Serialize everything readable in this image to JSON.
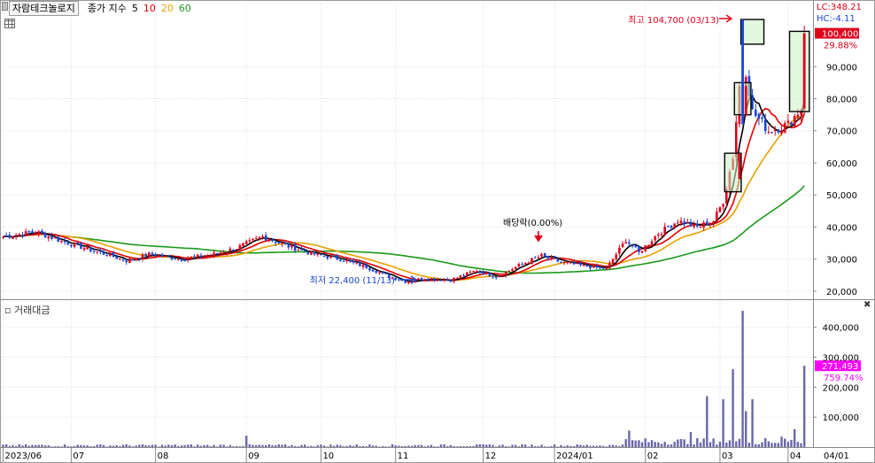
{
  "header": {
    "stock_name": "자람테크놀로지",
    "ma_label": "종가 지수",
    "ma_periods": [
      {
        "label": "5",
        "color": "#000000"
      },
      {
        "label": "10",
        "color": "#e00000"
      },
      {
        "label": "20",
        "color": "#e8a000"
      },
      {
        "label": "60",
        "color": "#1a9a1a"
      }
    ]
  },
  "price_panel": {
    "lc_label": "LC:348.21",
    "hc_label": "HC:-4.11",
    "current_price": "100,400",
    "current_change": "29.88%",
    "high_annotation": "최고 104,700 (03/13)",
    "low_annotation": "최저 22,400 (11/13)",
    "dividend_annotation": "배당락(0.00%)",
    "y_ticks": [
      {
        "v": 90000,
        "label": "90,000"
      },
      {
        "v": 80000,
        "label": "80,000"
      },
      {
        "v": 70000,
        "label": "70,000"
      },
      {
        "v": 60000,
        "label": "60,000"
      },
      {
        "v": 50000,
        "label": "50,000"
      },
      {
        "v": 40000,
        "label": "40,000"
      },
      {
        "v": 30000,
        "label": "30,000"
      },
      {
        "v": 20000,
        "label": "20,000"
      }
    ]
  },
  "volume_panel": {
    "title": "거래대금",
    "current_value": "271,493",
    "current_change": "759.74%",
    "y_ticks": [
      {
        "v": 400000,
        "label": "400,000"
      },
      {
        "v": 300000,
        "label": "300,000"
      },
      {
        "v": 200000,
        "label": "200,000"
      },
      {
        "v": 100000,
        "label": "100,000"
      }
    ]
  },
  "x_axis": {
    "ticks": [
      {
        "i": 0,
        "label": "2023/06"
      },
      {
        "i": 21,
        "label": "07"
      },
      {
        "i": 47,
        "label": "08"
      },
      {
        "i": 75,
        "label": "09"
      },
      {
        "i": 98,
        "label": "10"
      },
      {
        "i": 121,
        "label": "11"
      },
      {
        "i": 148,
        "label": "12"
      },
      {
        "i": 170,
        "label": "2024/01"
      },
      {
        "i": 198,
        "label": "02"
      },
      {
        "i": 221,
        "label": "03"
      },
      {
        "i": 242,
        "label": "04"
      }
    ],
    "last_label": "04/01"
  },
  "colors": {
    "up": "#e0001b",
    "down": "#1846d8",
    "ma5": "#000000",
    "ma10": "#e00000",
    "ma20": "#e8a000",
    "ma60": "#1a9a1a",
    "volume": "#6a67a8",
    "highlight_fill": "#c9f0c2",
    "tag_price": "#e0001b",
    "tag_volume": "#ff00ff"
  },
  "chart_data": {
    "type": "candlestick",
    "price_range": [
      17500,
      104700
    ],
    "volume_range": [
      0,
      470000
    ],
    "closing_path": [
      [
        0,
        37000
      ],
      [
        10,
        38500
      ],
      [
        20,
        35000
      ],
      [
        30,
        32000
      ],
      [
        38,
        29500
      ],
      [
        45,
        31500
      ],
      [
        55,
        30000
      ],
      [
        65,
        31500
      ],
      [
        72,
        33500
      ],
      [
        80,
        37000
      ],
      [
        88,
        34000
      ],
      [
        96,
        31500
      ],
      [
        104,
        30000
      ],
      [
        112,
        27500
      ],
      [
        118,
        25000
      ],
      [
        124,
        23000
      ],
      [
        130,
        24000
      ],
      [
        138,
        23500
      ],
      [
        146,
        26500
      ],
      [
        152,
        24500
      ],
      [
        160,
        28500
      ],
      [
        166,
        31000
      ],
      [
        172,
        29000
      ],
      [
        178,
        28000
      ],
      [
        186,
        27000
      ],
      [
        192,
        36000
      ],
      [
        196,
        32000
      ],
      [
        202,
        38000
      ],
      [
        208,
        42000
      ],
      [
        214,
        40000
      ],
      [
        219,
        42000
      ],
      [
        222,
        48000
      ],
      [
        225,
        62000
      ],
      [
        228,
        95000
      ],
      [
        231,
        76000
      ],
      [
        236,
        70000
      ],
      [
        242,
        72000
      ],
      [
        246,
        77000
      ],
      [
        247,
        100400
      ]
    ],
    "volume_spikes": [
      {
        "i": 75,
        "v": 38000
      },
      {
        "i": 193,
        "v": 55000
      },
      {
        "i": 212,
        "v": 50000
      },
      {
        "i": 217,
        "v": 170000
      },
      {
        "i": 222,
        "v": 160000
      },
      {
        "i": 225,
        "v": 260000
      },
      {
        "i": 228,
        "v": 455000
      },
      {
        "i": 229,
        "v": 120000
      },
      {
        "i": 231,
        "v": 160000
      },
      {
        "i": 235,
        "v": 30000
      },
      {
        "i": 240,
        "v": 35000
      },
      {
        "i": 244,
        "v": 60000
      },
      {
        "i": 247,
        "v": 271493
      }
    ],
    "highlight_boxes": [
      {
        "i0": 223,
        "i1": 227,
        "low": 51000,
        "high": 63000
      },
      {
        "i0": 226,
        "i1": 230,
        "low": 75000,
        "high": 85000
      },
      {
        "i0": 228,
        "i1": 234,
        "low": 97000,
        "high": 104700
      },
      {
        "i0": 243,
        "i1": 248,
        "low": 76000,
        "high": 101000
      }
    ]
  }
}
